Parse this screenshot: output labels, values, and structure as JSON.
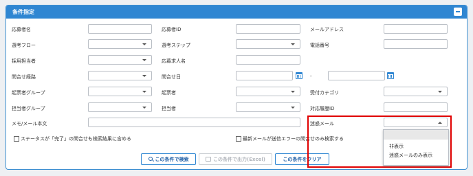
{
  "panel": {
    "title": "条件指定"
  },
  "fields": {
    "applicant_name": {
      "label": "応募者名",
      "value": ""
    },
    "applicant_id": {
      "label": "応募者ID",
      "value": ""
    },
    "email": {
      "label": "メールアドレス",
      "value": ""
    },
    "selection_flow": {
      "label": "選考フロー",
      "value": ""
    },
    "selection_step": {
      "label": "選考ステップ",
      "value": ""
    },
    "phone": {
      "label": "電話番号",
      "value": ""
    },
    "hiring_staff": {
      "label": "採用担当者",
      "value": ""
    },
    "job_posting_name": {
      "label": "応募求人名",
      "value": ""
    },
    "inquiry_route": {
      "label": "問合せ経路",
      "value": ""
    },
    "inquiry_date": {
      "label": "問合せ日",
      "from": "",
      "separator": "-",
      "to": ""
    },
    "creator_group": {
      "label": "起票者グループ",
      "value": ""
    },
    "creator": {
      "label": "起票者",
      "value": ""
    },
    "received_category": {
      "label": "受付カテゴリ",
      "value": ""
    },
    "staff_group": {
      "label": "担当者グループ",
      "value": ""
    },
    "staff": {
      "label": "担当者",
      "value": ""
    },
    "history_id": {
      "label": "対応履歴ID",
      "value": ""
    },
    "memo": {
      "label": "メモ/メール本文",
      "value": ""
    },
    "spam_mail": {
      "label": "迷惑メール",
      "value": "",
      "options": [
        "",
        "非表示",
        "迷惑メールのみ表示"
      ]
    }
  },
  "checkboxes": {
    "include_completed": {
      "label": "ステータスが「完了」の問合せも検索結果に含める",
      "checked": false
    },
    "send_error_only": {
      "label": "最新メールが送信エラーの問合せのみ検索する",
      "checked": false
    }
  },
  "buttons": {
    "search": "この条件で検索",
    "export": "この条件で出力(Excel)",
    "clear": "この条件をクリア"
  },
  "icons": {
    "calendar": "calendar-icon",
    "search": "search-icon",
    "printer": "printer-icon",
    "collapse": "minus-icon"
  },
  "colors": {
    "header": "#2f86d2",
    "highlight": "#e00000"
  }
}
